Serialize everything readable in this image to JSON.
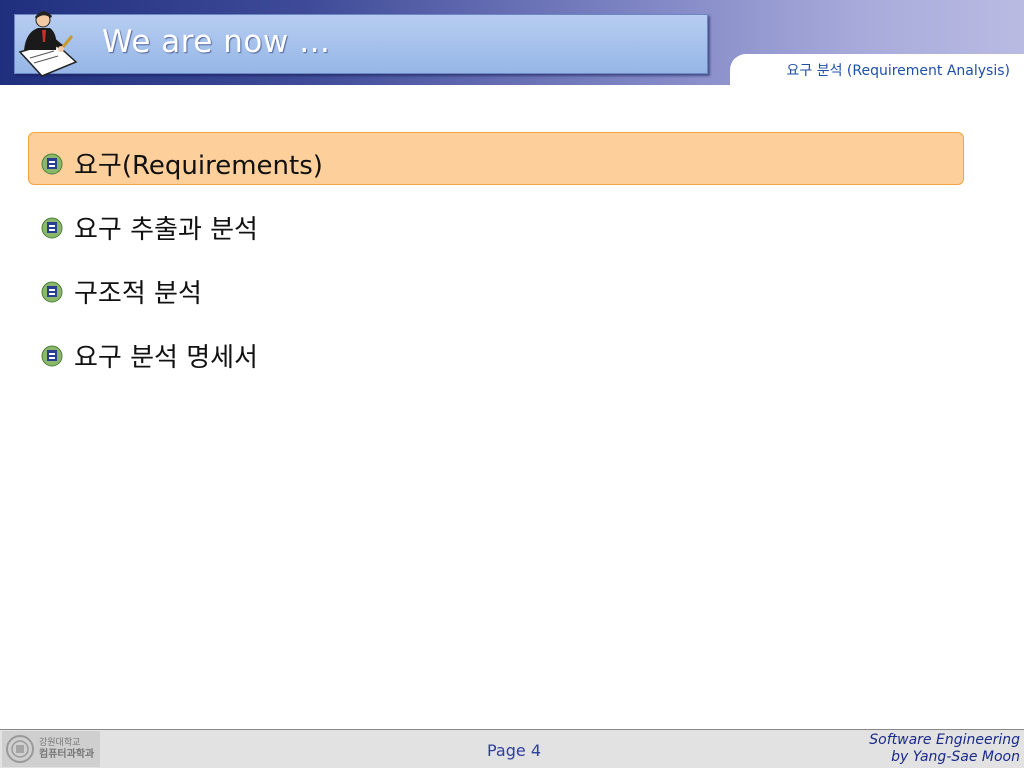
{
  "slide": {
    "title": "We are now …",
    "subtitle": "요구 분석 (Requirement Analysis)"
  },
  "outline": {
    "items": [
      {
        "label": "요구(Requirements)",
        "highlighted": true
      },
      {
        "label": "요구 추출과 분석",
        "highlighted": false
      },
      {
        "label": "구조적 분석",
        "highlighted": false
      },
      {
        "label": "요구 분석 명세서",
        "highlighted": false
      }
    ]
  },
  "footer": {
    "page": "Page 4",
    "course": "Software Engineering",
    "author": "by Yang-Sae Moon",
    "logo_line1": "강원대학교",
    "logo_line2": "컴퓨터과학과"
  },
  "colors": {
    "highlight_fill": "#fdd09b",
    "highlight_border": "#f2a447",
    "subtitle_text": "#1f4fa8",
    "footer_text": "#2e3f9e"
  },
  "icons": {
    "header_figure": "person-with-pen-icon",
    "bullet": "university-emblem-icon",
    "footer_logo": "university-seal-icon"
  }
}
